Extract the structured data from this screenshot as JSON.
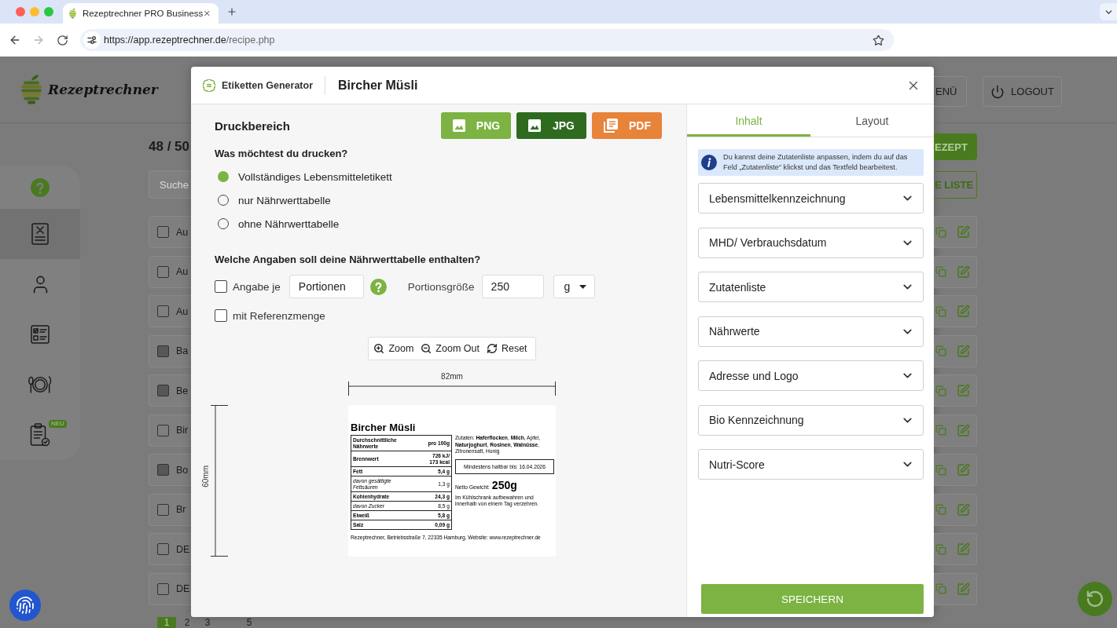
{
  "browser": {
    "tab_title": "Rezeptrechner PRO Business",
    "url_host": "https://app.rezeptrechner.de",
    "url_path": "/recipe.php"
  },
  "app": {
    "logo_text": "Rezeptrechner",
    "header_buttons": [
      {
        "kind": "menu",
        "label": "ENÜ"
      },
      {
        "kind": "logout",
        "label": "LOGOUT"
      }
    ],
    "sidebar": [
      {
        "kind": "help",
        "selected": false
      },
      {
        "kind": "recipes",
        "selected": true
      },
      {
        "kind": "user",
        "selected": false
      },
      {
        "kind": "checklist",
        "selected": false
      },
      {
        "kind": "plate",
        "selected": false
      },
      {
        "kind": "clipboard",
        "selected": false,
        "badge": "NEU"
      }
    ],
    "recipe_count": "48 / 50",
    "search": {
      "placeholder": "Suche"
    },
    "action_buttons": [
      {
        "kind": "filled",
        "label": "EZEPT"
      },
      {
        "kind": "outline",
        "label": "E LISTE"
      }
    ],
    "rows": [
      {
        "name": "Au",
        "disabled": false
      },
      {
        "name": "Au",
        "disabled": false
      },
      {
        "name": "Au",
        "disabled": false
      },
      {
        "name": "Ba",
        "disabled": true
      },
      {
        "name": "Be",
        "disabled": true
      },
      {
        "name": "Bir",
        "disabled": false
      },
      {
        "name": "Bo",
        "disabled": true
      },
      {
        "name": "Br",
        "disabled": false
      },
      {
        "name": "DE",
        "disabled": false
      },
      {
        "name": "DE",
        "disabled": false
      }
    ],
    "pagination": [
      {
        "label": "1",
        "selected": true
      },
      {
        "label": "2",
        "selected": false
      },
      {
        "label": "3",
        "selected": false
      },
      {
        "label": "5",
        "selected": false
      }
    ]
  },
  "modal": {
    "tool_title": "Etiketten Generator",
    "recipe_title": "Bircher Müsli",
    "print_area": {
      "title": "Druckbereich",
      "export_buttons": [
        {
          "kind": "image",
          "label": "PNG",
          "color": "#7cb342"
        },
        {
          "kind": "image",
          "label": "JPG",
          "color": "#2f6b1f"
        },
        {
          "kind": "pdf",
          "label": "PDF",
          "color": "#e8833a"
        }
      ],
      "print_question": "Was möchtest du drucken?",
      "print_options": [
        {
          "label": "Vollständiges Lebensmitteletikett",
          "selected": true
        },
        {
          "label": "nur Nährwerttabelle",
          "selected": false
        },
        {
          "label": "ohne Nährwerttabelle",
          "selected": false
        }
      ],
      "nutrition_question": "Welche Angaben soll deine Nährwerttabelle enthalten?",
      "per_unit": {
        "label": "Angabe je",
        "checked": false,
        "value": "Portionen"
      },
      "portion_size": {
        "label": "Portionsgröße",
        "value": "250",
        "unit": "g"
      },
      "reference": {
        "label": "mit Referenzmenge",
        "checked": false
      },
      "zoom_tools": [
        {
          "kind": "zoom_in",
          "label": "Zoom"
        },
        {
          "kind": "zoom_out",
          "label": "Zoom Out"
        },
        {
          "kind": "reset",
          "label": "Reset"
        }
      ],
      "width_label": "82mm",
      "height_label": "60mm",
      "label": {
        "title": "Bircher Müsli",
        "nutrition_header": {
          "name": "Durchschnittliche Nährwerte",
          "value": "pro 100g"
        },
        "nutrition_rows": [
          {
            "kind": "main",
            "name": "Brennwert",
            "value": "726 kJ/ 173 kcal"
          },
          {
            "kind": "main",
            "name": "Fett",
            "value": "5,4 g"
          },
          {
            "kind": "sub",
            "name": "davon gesättigte Fettsäuren",
            "value": "1,3 g"
          },
          {
            "kind": "main",
            "name": "Kohlenhydrate",
            "value": "24,3 g"
          },
          {
            "kind": "sub",
            "name": "davon Zucker",
            "value": "8,5 g"
          },
          {
            "kind": "main",
            "name": "Eiweiß",
            "value": "5,8 g"
          },
          {
            "kind": "main",
            "name": "Salz",
            "value": "0,09 g"
          }
        ],
        "ingredients": "Zutaten: **Haferflocken**, **Milch**, Apfel, **Naturjoghurt**, **Rosinen**, **Walnüsse**, Zitronensaft, Honig",
        "best_before": "Mindestens haltbar bis: 16.04.2026",
        "net_weight_label": "Netto Gewicht:",
        "net_weight": "250g",
        "storage": "Im Kühlschrank aufbewahren und innerhalb von einem Tag verzehren.",
        "footer": "Rezeptrechner, Betriebsstraße 7, 22335 Hamburg, Website: www.rezeptrechner.de"
      }
    },
    "panel": {
      "tabs": [
        {
          "label": "Inhalt",
          "selected": true
        },
        {
          "label": "Layout",
          "selected": false
        }
      ],
      "info": "Du kannst deine Zutatenliste anpassen, indem du auf das Feld „Zutatenliste“ klickst und das Textfeld bearbeitest.",
      "sections": [
        {
          "title": "Lebensmittelkennzeichnung",
          "expanded": false
        },
        {
          "title": "MHD/ Verbrauchsdatum",
          "expanded": false
        },
        {
          "title": "Zutatenliste",
          "expanded": false
        },
        {
          "title": "Nährwerte",
          "expanded": false
        },
        {
          "title": "Adresse und Logo",
          "expanded": false
        },
        {
          "title": "Bio Kennzeichnung",
          "expanded": false
        },
        {
          "title": "Nutri-Score",
          "expanded": false
        }
      ],
      "save_label": "SPEICHERN"
    }
  }
}
